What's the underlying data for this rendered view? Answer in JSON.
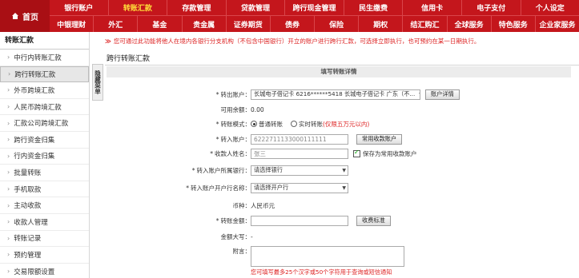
{
  "nav": {
    "home": "首页",
    "row1": [
      "银行账户",
      "转账汇款",
      "存款管理",
      "贷款管理",
      "跨行现金管理",
      "民生缴费",
      "信用卡",
      "电子支付",
      "个人设定"
    ],
    "row2": [
      "中银理财",
      "外汇",
      "基金",
      "贵金属",
      "证券期货",
      "债券",
      "保险",
      "期权",
      "结汇购汇",
      "全球服务",
      "特色服务",
      "企业家服务"
    ],
    "active": "转账汇款"
  },
  "sidebar": {
    "title": "转账汇款",
    "items": [
      "中行内转账汇款",
      "跨行转账汇款",
      "外币跨境汇款",
      "人民币跨境汇款",
      "汇款公司跨境汇款",
      "跨行资金归集",
      "行内资金归集",
      "批量转账",
      "手机取款",
      "主动收款",
      "收款人管理",
      "转账记录",
      "预约管理",
      "交易限额设置"
    ],
    "active_index": 1
  },
  "collapse_label": "隐藏菜单",
  "notice": {
    "mark": "≫",
    "text": "您可通过此功能将他人在境内各银行分支机构（不包含中国银行）开立的账户进行跨行汇款，可选择立即执行，也可预约在某一日期执行。"
  },
  "section_title": "跨行转账汇款",
  "form_header": "填写转账详情",
  "form": {
    "from_account": {
      "label": "转出账户",
      "required": true,
      "value": "长城电子借记卡 6216******5418 长城电子借记卡 广东（不...",
      "button": "账户详情"
    },
    "balance": {
      "label": "可用余额",
      "value": "0.00"
    },
    "mode": {
      "label": "转账模式",
      "required": true,
      "option1": "普通转账",
      "option2": "实时转账",
      "option2_note": "(仅限五万元以内)"
    },
    "to_account": {
      "label": "转入账户",
      "required": true,
      "value": "6222711133000111111",
      "button": "常用收款账户"
    },
    "payee_name": {
      "label": "收款人姓名",
      "required": true,
      "value": "张三",
      "checkbox": "保存为常用收款账户"
    },
    "bank": {
      "label": "转入账户所属银行",
      "required": true,
      "placeholder": "请选择银行"
    },
    "branch": {
      "label": "转入账户开户行名称",
      "required": true,
      "placeholder": "请选择开户行"
    },
    "currency": {
      "label": "币种",
      "value": "人民币元"
    },
    "amount": {
      "label": "转账金额",
      "required": true,
      "value": "",
      "button": "收费标准"
    },
    "amount_caps": {
      "label": "金额大写",
      "value": "-"
    },
    "memo": {
      "label": "附言",
      "hint": "您可填写最多25个汉字或50个字符用于查询或短信通知"
    }
  },
  "colors": {
    "nav_bg": "#c4161c",
    "nav_active": "#ffde3a",
    "notice": "#dd2222"
  }
}
